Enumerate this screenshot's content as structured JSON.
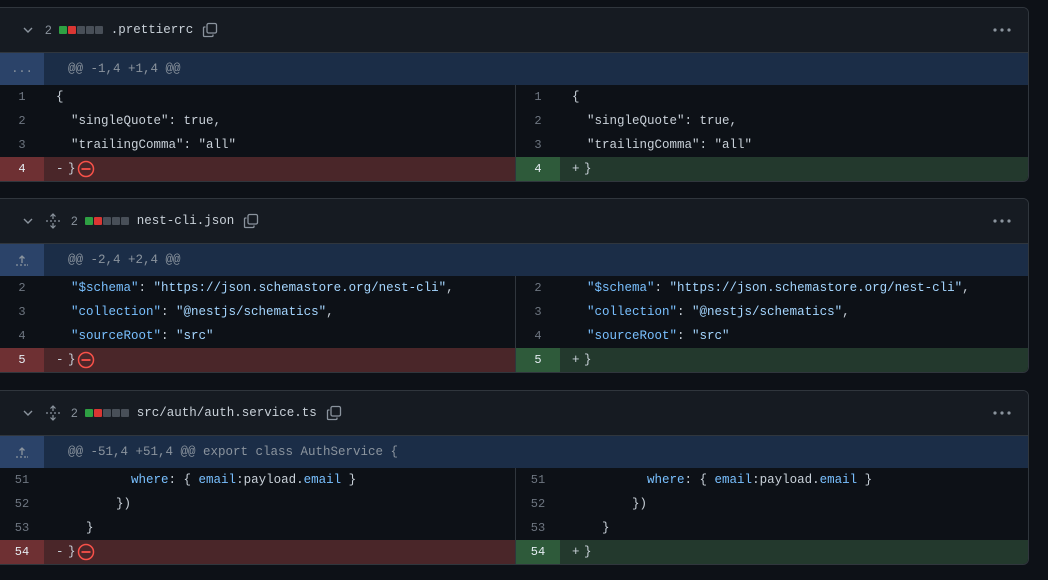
{
  "files": [
    {
      "count": "2",
      "name": ".prettierrc",
      "hunk": "@@ -1,4 +1,4 @@",
      "hunk_gutter": "...",
      "left": [
        {
          "n": "1",
          "parts": [
            {
              "t": "{"
            }
          ]
        },
        {
          "n": "2",
          "parts": [
            {
              "t": "  \"singleQuote\": true,"
            }
          ]
        },
        {
          "n": "3",
          "parts": [
            {
              "t": "  \"trailingComma\": \"all\""
            }
          ]
        }
      ],
      "right": [
        {
          "n": "1",
          "parts": [
            {
              "t": "{"
            }
          ]
        },
        {
          "n": "2",
          "parts": [
            {
              "t": "  \"singleQuote\": true,"
            }
          ]
        },
        {
          "n": "3",
          "parts": [
            {
              "t": "  \"trailingComma\": \"all\""
            }
          ]
        }
      ],
      "del": {
        "n": "4",
        "mark": "-",
        "text": "}"
      },
      "add": {
        "n": "4",
        "mark": "+",
        "text": "}"
      }
    },
    {
      "count": "2",
      "name": "nest-cli.json",
      "hunk": "@@ -2,4 +2,4 @@",
      "left": [
        {
          "n": "2",
          "parts": [
            {
              "t": "  "
            },
            {
              "t": "\"$schema\"",
              "c": "k"
            },
            {
              "t": ": "
            },
            {
              "t": "\"https://json.schemastore.org/nest-cli\"",
              "c": "s"
            },
            {
              "t": ","
            }
          ]
        },
        {
          "n": "3",
          "parts": [
            {
              "t": "  "
            },
            {
              "t": "\"collection\"",
              "c": "k"
            },
            {
              "t": ": "
            },
            {
              "t": "\"@nestjs/schematics\"",
              "c": "s"
            },
            {
              "t": ","
            }
          ]
        },
        {
          "n": "4",
          "parts": [
            {
              "t": "  "
            },
            {
              "t": "\"sourceRoot\"",
              "c": "k"
            },
            {
              "t": ": "
            },
            {
              "t": "\"src\"",
              "c": "s"
            }
          ]
        }
      ],
      "right": [
        {
          "n": "2",
          "parts": [
            {
              "t": "  "
            },
            {
              "t": "\"$schema\"",
              "c": "k"
            },
            {
              "t": ": "
            },
            {
              "t": "\"https://json.schemastore.org/nest-cli\"",
              "c": "s"
            },
            {
              "t": ","
            }
          ]
        },
        {
          "n": "3",
          "parts": [
            {
              "t": "  "
            },
            {
              "t": "\"collection\"",
              "c": "k"
            },
            {
              "t": ": "
            },
            {
              "t": "\"@nestjs/schematics\"",
              "c": "s"
            },
            {
              "t": ","
            }
          ]
        },
        {
          "n": "4",
          "parts": [
            {
              "t": "  "
            },
            {
              "t": "\"sourceRoot\"",
              "c": "k"
            },
            {
              "t": ": "
            },
            {
              "t": "\"src\"",
              "c": "s"
            }
          ]
        }
      ],
      "del": {
        "n": "5",
        "mark": "-",
        "text": "}"
      },
      "add": {
        "n": "5",
        "mark": "+",
        "text": "}"
      }
    },
    {
      "count": "2",
      "name": "src/auth/auth.service.ts",
      "hunk": "@@ -51,4 +51,4 @@ export class AuthService {",
      "left": [
        {
          "n": "51",
          "parts": [
            {
              "t": "          "
            },
            {
              "t": "where",
              "c": "kw"
            },
            {
              "t": ": { "
            },
            {
              "t": "email",
              "c": "kw"
            },
            {
              "t": ":payload."
            },
            {
              "t": "email",
              "c": "kw"
            },
            {
              "t": " }"
            }
          ]
        },
        {
          "n": "52",
          "parts": [
            {
              "t": "        })"
            }
          ]
        },
        {
          "n": "53",
          "parts": [
            {
              "t": "    }"
            }
          ]
        }
      ],
      "right": [
        {
          "n": "51",
          "parts": [
            {
              "t": "          "
            },
            {
              "t": "where",
              "c": "kw"
            },
            {
              "t": ": { "
            },
            {
              "t": "email",
              "c": "kw"
            },
            {
              "t": ":payload."
            },
            {
              "t": "email",
              "c": "kw"
            },
            {
              "t": " }"
            }
          ]
        },
        {
          "n": "52",
          "parts": [
            {
              "t": "        })"
            }
          ]
        },
        {
          "n": "53",
          "parts": [
            {
              "t": "    }"
            }
          ]
        }
      ],
      "del": {
        "n": "54",
        "mark": "-",
        "text": "}"
      },
      "add": {
        "n": "54",
        "mark": "+",
        "text": "}"
      }
    }
  ],
  "colors": {
    "added": "#2ea043",
    "deleted": "#da3633",
    "neutral": "#484f58",
    "deleted_icon": "#f85149"
  },
  "icons": [
    "chevron-down-icon",
    "unfold-icon",
    "copy-icon",
    "kebab-icon",
    "fold-up-icon",
    "no-entry-icon"
  ]
}
